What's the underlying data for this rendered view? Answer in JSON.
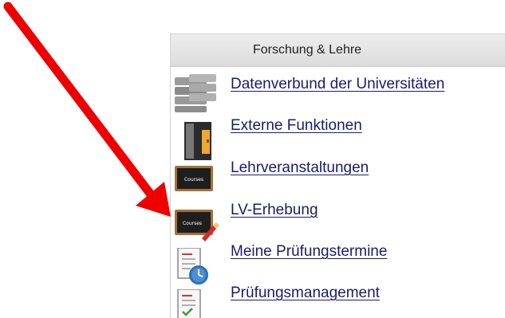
{
  "panel": {
    "title": "Forschung & Lehre",
    "items": [
      {
        "label": "Datenverbund der Universitäten",
        "icon": "database-icon"
      },
      {
        "label": "Externe Funktionen",
        "icon": "door-icon"
      },
      {
        "label": "Lehrveranstaltungen",
        "icon": "blackboard-icon",
        "icon_text": "Courses"
      },
      {
        "label": "LV-Erhebung",
        "icon": "blackboard-pencil-icon",
        "icon_text": "Courses"
      },
      {
        "label": "Meine Prüfungstermine",
        "icon": "exam-clock-icon"
      },
      {
        "label": "Prüfungsmanagement",
        "icon": "exam-management-icon"
      }
    ]
  },
  "annotation": {
    "arrow_color": "#ee0000",
    "points_to": "LV-Erhebung"
  }
}
